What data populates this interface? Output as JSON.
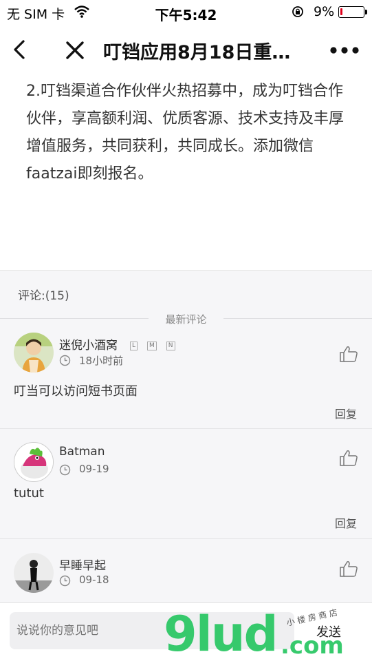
{
  "status_bar": {
    "carrier": "无 SIM 卡",
    "time": "下午5:42",
    "battery": "9%",
    "battery_level": 0.09
  },
  "nav": {
    "title": "叮铛应用8月18日重…"
  },
  "article": {
    "text": "2.叮铛渠道合作伙伴火热招募中，成为叮铛合作伙伴，享高额利润、优质客源、技术支持及丰厚增值服务，共同获利，共同成长。添加微信faatzai即刻报名。"
  },
  "comments": {
    "count_label": "评论:(15)",
    "latest_label": "最新评论",
    "items": [
      {
        "name": "迷倪小酒窝",
        "badges": [
          "L",
          "M",
          "N"
        ],
        "time": "18小时前",
        "text": "叮当可以访问短书页面",
        "reply": "回复"
      },
      {
        "name": "Batman",
        "badges": [],
        "time": "09-19",
        "text": "tutut",
        "reply": "回复"
      },
      {
        "name": "早睡早起",
        "badges": [],
        "time": "09-18",
        "text": "",
        "reply": ""
      }
    ]
  },
  "input": {
    "placeholder": "说说你的意见吧",
    "send_label": "发送"
  },
  "watermark": {
    "main": "9lud",
    "suffix": ".com",
    "small": "小 楼 房 商 店"
  },
  "colors": {
    "battery_low": "#e0001b",
    "watermark": "#22c55e",
    "comments_bg": "#f6f6f8"
  }
}
